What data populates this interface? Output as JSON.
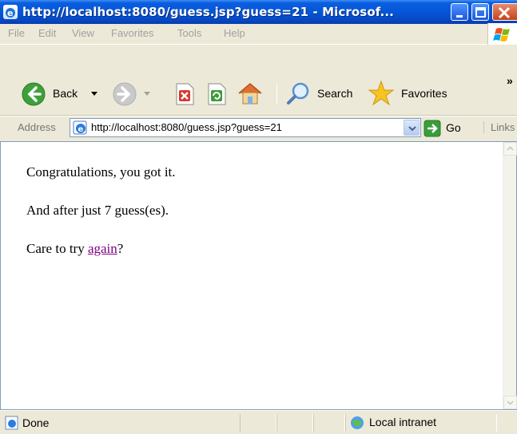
{
  "window": {
    "title": "http://localhost:8080/guess.jsp?guess=21 - Microsof..."
  },
  "menu": [
    "File",
    "Edit",
    "View",
    "Favorites",
    "Tools",
    "Help"
  ],
  "toolbar": {
    "back_label": "Back",
    "search_label": "Search",
    "favorites_label": "Favorites",
    "overflow": "»"
  },
  "address": {
    "label": "Address",
    "url": "http://localhost:8080/guess.jsp?guess=21",
    "go_label": "Go",
    "links_label": "Links"
  },
  "page": {
    "line1": "Congratulations, you got it.",
    "line2": "And after just 7 guess(es).",
    "line3_prefix": "Care to try ",
    "line3_link": "again",
    "line3_suffix": "?"
  },
  "status": {
    "text": "Done",
    "zone": "Local intranet"
  },
  "colors": {
    "titlebar": "#0556d6",
    "visited_link": "#800080",
    "chrome": "#ece9d8"
  }
}
